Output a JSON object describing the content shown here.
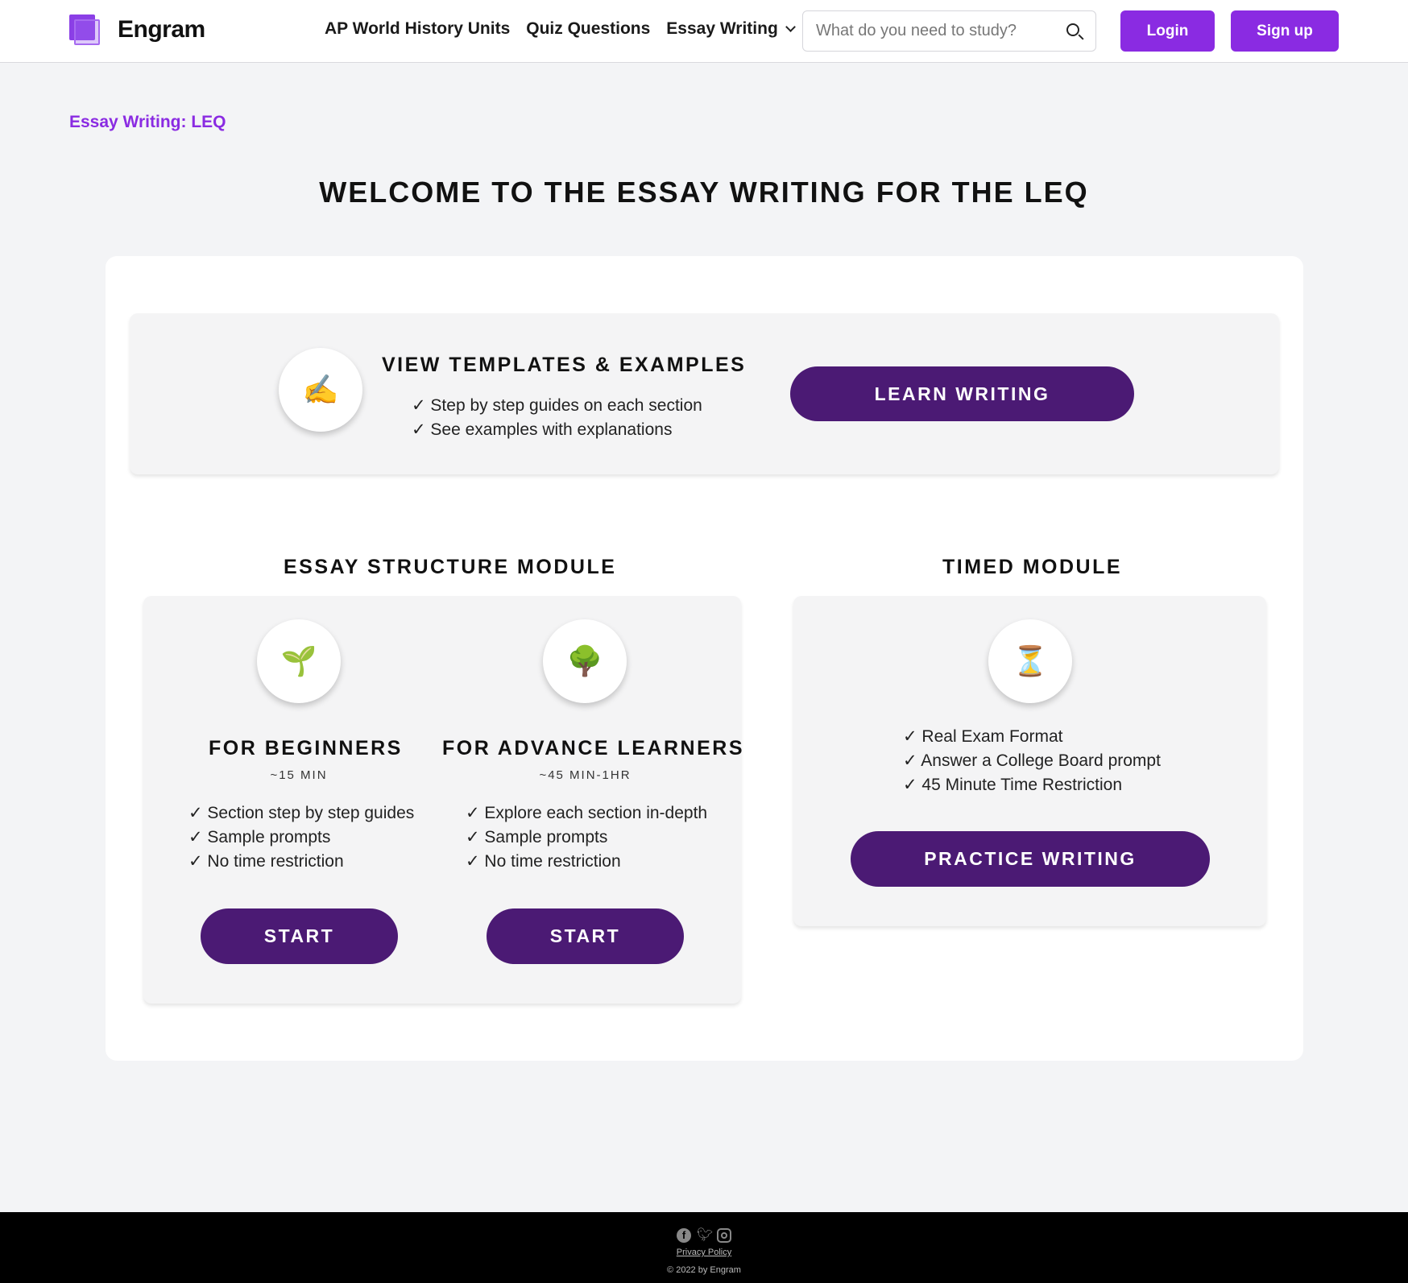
{
  "header": {
    "brand": "Engram",
    "nav": [
      {
        "label": "AP World History Units"
      },
      {
        "label": "Quiz Questions"
      },
      {
        "label": "Essay Writing"
      }
    ],
    "search": {
      "placeholder": "What do you need to study?",
      "value": ""
    },
    "login_label": "Login",
    "signup_label": "Sign up"
  },
  "breadcrumb": "Essay Writing: LEQ",
  "page_title": "WELCOME TO THE ESSAY WRITING FOR THE LEQ",
  "templates": {
    "icon": "✍️",
    "icon_name": "writing-hand-icon",
    "heading": "VIEW TEMPLATES & EXAMPLES",
    "points": [
      "✓ Step by step guides on each section",
      "✓ See examples with explanations"
    ],
    "button": "LEARN WRITING"
  },
  "structure_module": {
    "heading": "ESSAY STRUCTURE MODULE",
    "beginners": {
      "icon": "🌱",
      "icon_name": "seedling-icon",
      "heading": "FOR BEGINNERS",
      "duration": "~15 MIN",
      "points": [
        "✓ Section step by step guides",
        "✓ Sample prompts",
        "✓ No time restriction"
      ],
      "button": "START"
    },
    "advanced": {
      "icon": "🌳",
      "icon_name": "tree-icon",
      "heading": "FOR ADVANCE LEARNERS",
      "duration": "~45 MIN-1HR",
      "points": [
        "✓ Explore each section in-depth",
        "✓ Sample prompts",
        "✓ No time restriction"
      ],
      "button": "START"
    }
  },
  "timed_module": {
    "heading": "TIMED MODULE",
    "icon": "⏳",
    "icon_name": "hourglass-icon",
    "points": [
      "✓ Real Exam Format",
      "✓ Answer a College Board prompt",
      "✓ 45 Minute Time Restriction"
    ],
    "button": "PRACTICE WRITING"
  },
  "footer": {
    "social_icons": [
      "facebook-icon",
      "twitter-icon",
      "instagram-icon"
    ],
    "privacy": "Privacy Policy",
    "copyright": "© 2022 by Engram"
  },
  "colors": {
    "accent": "#8a2be2",
    "dark_button": "#4b1a74",
    "background": "#f3f4f6",
    "footer": "#000000"
  }
}
